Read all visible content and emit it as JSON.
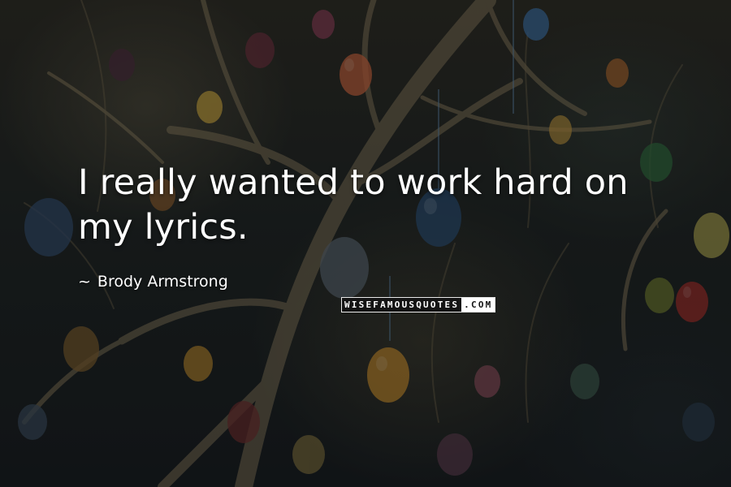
{
  "quote": {
    "text": "I really wanted to work hard on my lyrics.",
    "author": "Brody Armstrong",
    "author_prefix": "~"
  },
  "watermark": {
    "main": "WISEFAMOUSQUOTES",
    "suffix": ".COM"
  },
  "colors": {
    "text": "#ffffff",
    "background": "#1d211f"
  }
}
